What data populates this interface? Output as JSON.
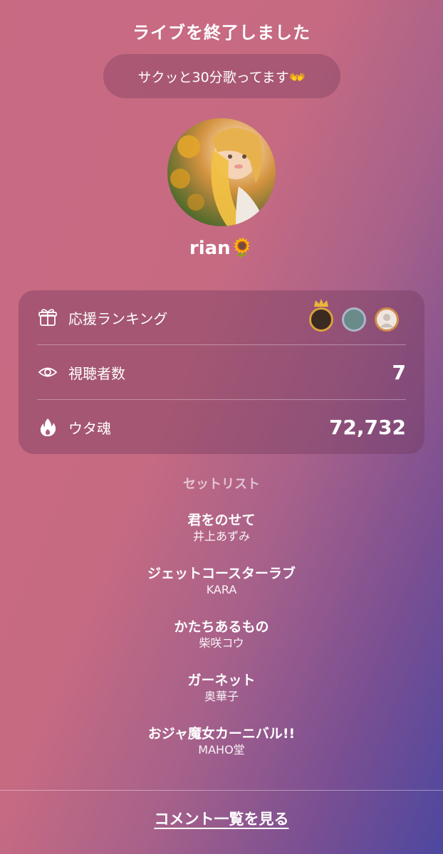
{
  "header": {
    "title": "ライブを終了しました"
  },
  "live": {
    "stream_title": "サクッと30分歌ってます👐"
  },
  "profile": {
    "username": "rian🌻"
  },
  "stats": {
    "ranking_label": "応援ランキング",
    "viewers_label": "視聴者数",
    "viewers_value": "7",
    "uta_label": "ウタ魂",
    "uta_value": "72,732"
  },
  "icons": {
    "ranking": "gift-icon",
    "viewers": "eye-icon",
    "uta": "flame-icon"
  },
  "colors": {
    "badge_gold": "#d9a23a",
    "badge_silver": "#a9b7c8",
    "badge_bronze": "#d08a4a"
  },
  "setlist": {
    "heading": "セットリスト",
    "songs": [
      {
        "title": "君をのせて",
        "artist": "井上あずみ"
      },
      {
        "title": "ジェットコースターラブ",
        "artist": "KARA"
      },
      {
        "title": "かたちあるもの",
        "artist": "柴咲コウ"
      },
      {
        "title": "ガーネット",
        "artist": "奥華子"
      },
      {
        "title": "おジャ魔女カーニバル!!",
        "artist": "MAHO堂"
      }
    ]
  },
  "footer": {
    "comment_link": "コメント一覧を見る"
  }
}
